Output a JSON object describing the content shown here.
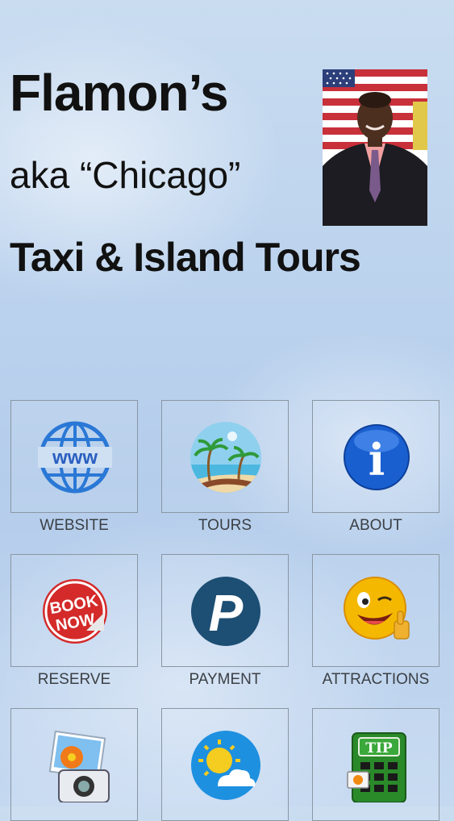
{
  "header": {
    "line1": "Flamon’s",
    "line2": "aka “Chicago”",
    "line3": "Taxi & Island Tours"
  },
  "tiles": [
    {
      "label": "WEBSITE",
      "icon": "globe-www-icon"
    },
    {
      "label": "TOURS",
      "icon": "beach-palm-icon"
    },
    {
      "label": "ABOUT",
      "icon": "info-icon"
    },
    {
      "label": "RESERVE",
      "icon": "book-now-sticker-icon"
    },
    {
      "label": "PAYMENT",
      "icon": "paypal-p-icon"
    },
    {
      "label": "ATTRACTIONS",
      "icon": "smiley-thumbs-up-icon"
    },
    {
      "label": "",
      "icon": "photo-camera-icon"
    },
    {
      "label": "",
      "icon": "weather-sun-cloud-icon"
    },
    {
      "label": "",
      "icon": "tip-calculator-icon"
    }
  ],
  "icon_text": {
    "www": "www",
    "book": "BOOK",
    "now": "NOW",
    "paypal": "P",
    "info": "i",
    "tip": "TIP"
  }
}
